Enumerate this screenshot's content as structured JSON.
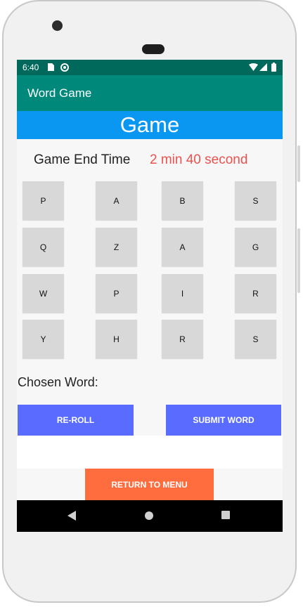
{
  "status_bar": {
    "time": "6:40"
  },
  "app_bar": {
    "title": "Word Game"
  },
  "banner": {
    "title": "Game"
  },
  "timer": {
    "label": "Game End Time",
    "value": "2 min 40 second"
  },
  "grid": {
    "rows": [
      [
        "P",
        "A",
        "B",
        "S"
      ],
      [
        "Q",
        "Z",
        "A",
        "G"
      ],
      [
        "W",
        "P",
        "I",
        "R"
      ],
      [
        "Y",
        "H",
        "R",
        "S"
      ]
    ]
  },
  "chosen_word": {
    "label": "Chosen Word:"
  },
  "buttons": {
    "reroll": "RE-ROLL",
    "submit": "SUBMIT WORD",
    "return_menu": "RETURN TO MENU"
  },
  "colors": {
    "statusbar": "#00695c",
    "appbar": "#00897b",
    "banner": "#0a97f2",
    "timer_value": "#e8534f",
    "action_button": "#5a6cff",
    "menu_button": "#ff6d3f"
  },
  "icons": [
    "sim-card-icon",
    "sync-icon",
    "wifi-icon",
    "signal-icon",
    "battery-icon",
    "nav-back-icon",
    "nav-home-icon",
    "nav-recents-icon"
  ]
}
